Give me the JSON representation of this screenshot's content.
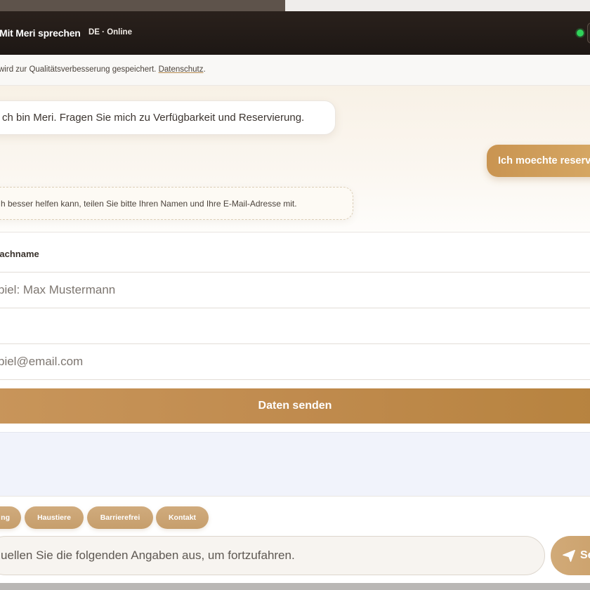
{
  "header": {
    "title": "Mit Meri sprechen",
    "status": "DE · Online"
  },
  "privacy": {
    "text": "wird zur Qualitätsverbesserung gespeichert.",
    "link": "Datenschutz",
    "suffix": "."
  },
  "messages": {
    "bot_greeting": "ch bin Meri. Fragen Sie mich zu Verfügbarkeit und Reservierung.",
    "user_message": "Ich moechte reserv",
    "bot_hint": "h besser helfen kann, teilen Sie bitte Ihren Namen und Ihre E-Mail-Adresse mit."
  },
  "form": {
    "name_label": "Nachname",
    "name_placeholder": "piel: Max Mustermann",
    "email_placeholder": "piel@email.com",
    "submit_label": "Daten senden"
  },
  "chips": [
    "ng",
    "Haustiere",
    "Barrierefrei",
    "Kontakt"
  ],
  "composer": {
    "placeholder": "uellen Sie die folgenden Angaben aus, um fortzufahren.",
    "send_label": "Se"
  },
  "colors": {
    "header_bg": "#1d1714",
    "accent": "#c8955a",
    "online": "#2fd35a"
  }
}
